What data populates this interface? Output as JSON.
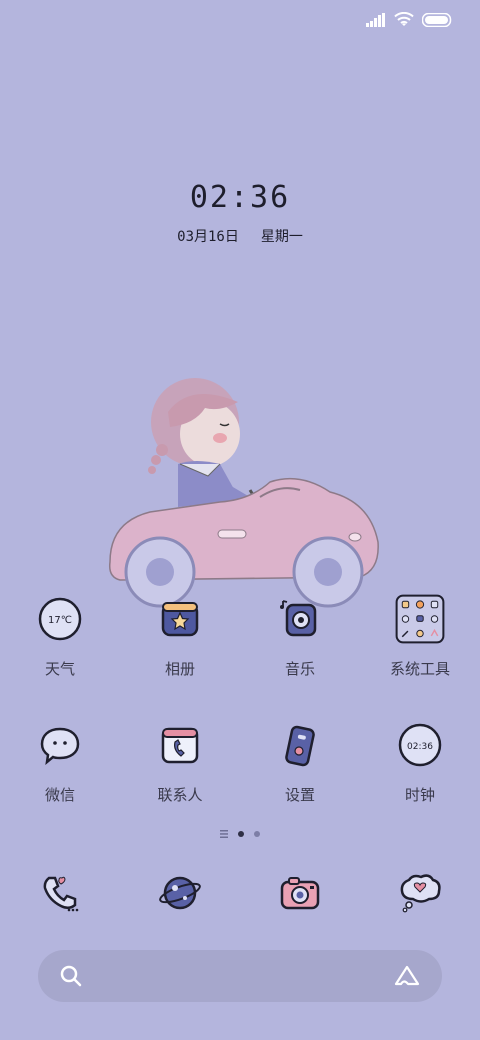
{
  "status_bar": {
    "icons": [
      "signal-icon",
      "wifi-icon",
      "battery-icon"
    ]
  },
  "lockscreen": {
    "time": "02:36",
    "date": "03月16日",
    "weekday": "星期一"
  },
  "apps": {
    "row1": [
      {
        "label": "天气",
        "icon": "weather-icon",
        "icon_text": "17℃"
      },
      {
        "label": "相册",
        "icon": "gallery-icon"
      },
      {
        "label": "音乐",
        "icon": "music-icon"
      },
      {
        "label": "系统工具",
        "icon": "system-tools-folder-icon"
      }
    ],
    "row2": [
      {
        "label": "微信",
        "icon": "wechat-icon"
      },
      {
        "label": "联系人",
        "icon": "contacts-icon"
      },
      {
        "label": "设置",
        "icon": "settings-icon"
      },
      {
        "label": "时钟",
        "icon": "clock-icon",
        "icon_text": "02:36"
      }
    ]
  },
  "page_indicator": {
    "pages": 2,
    "current": 1
  },
  "dock": [
    {
      "icon": "phone-icon"
    },
    {
      "icon": "browser-planet-icon"
    },
    {
      "icon": "camera-icon"
    },
    {
      "icon": "messages-icon"
    }
  ],
  "search": {
    "left_icon": "search-icon",
    "right_icon": "assistant-icon"
  },
  "colors": {
    "background": "#b4b5dd",
    "search_bar": "#a6a7cc",
    "outline": "#1f1f2e"
  }
}
